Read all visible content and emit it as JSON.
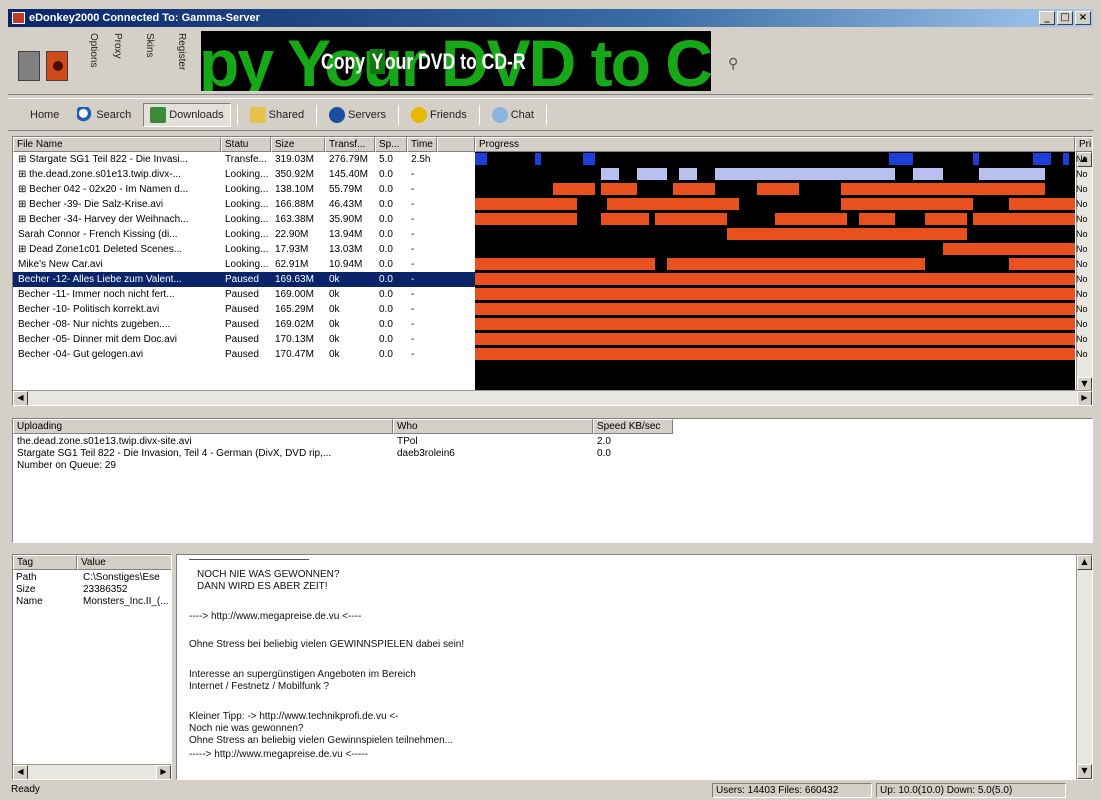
{
  "window": {
    "title": "eDonkey2000 Connected To: Gamma-Server",
    "buttons": [
      "_",
      "□",
      "×"
    ]
  },
  "toolbar": {
    "vertical_labels": [
      "Options",
      "Proxy",
      "Skins",
      "Register"
    ],
    "banner_bg_text": "py Your DVD to CD",
    "banner_fg_pre": "Copy ",
    "banner_fg_y": "Y",
    "banner_fg_post": "our DVD to CD-R"
  },
  "nav": {
    "home": "Home",
    "search": "Search",
    "downloads": "Downloads",
    "shared": "Shared",
    "servers": "Servers",
    "friends": "Friends",
    "chat": "Chat"
  },
  "downloads": {
    "columns": [
      "File Name",
      "Statu",
      "Size",
      "Transf...",
      "Sp...",
      "Time",
      "Progress",
      "Pri"
    ],
    "rows": [
      {
        "name": "⊞ Stargate SG1 Teil 822 - Die Invasi...",
        "status": "Transfe...",
        "size": "319.03M",
        "transf": "276.79M",
        "speed": "5.0",
        "time": "2.5h"
      },
      {
        "name": "⊞ the.dead.zone.s01e13.twip.divx-...",
        "status": "Looking...",
        "size": "350.92M",
        "transf": "145.40M",
        "speed": "0.0",
        "time": "-"
      },
      {
        "name": "⊞ Becher 042 - 02x20 - Im Namen d...",
        "status": "Looking...",
        "size": "138.10M",
        "transf": "55.79M",
        "speed": "0.0",
        "time": "-"
      },
      {
        "name": "⊞ Becher -39- Die Salz-Krise.avi",
        "status": "Looking...",
        "size": "166.88M",
        "transf": "46.43M",
        "speed": "0.0",
        "time": "-"
      },
      {
        "name": "⊞ Becher -34- Harvey der Weihnach...",
        "status": "Looking...",
        "size": "163.38M",
        "transf": "35.90M",
        "speed": "0.0",
        "time": "-"
      },
      {
        "name": "Sarah Connor - French Kissing (di...",
        "status": "Looking...",
        "size": "22.90M",
        "transf": "13.94M",
        "speed": "0.0",
        "time": "-"
      },
      {
        "name": "⊞ Dead Zone1c01 Deleted Scenes...",
        "status": "Looking...",
        "size": "17.93M",
        "transf": "13.03M",
        "speed": "0.0",
        "time": "-"
      },
      {
        "name": "Mike's New Car.avi",
        "status": "Looking...",
        "size": "62.91M",
        "transf": "10.94M",
        "speed": "0.0",
        "time": "-"
      },
      {
        "name": "Becher -12- Alles Liebe zum Valent...",
        "status": "Paused",
        "size": "169.63M",
        "transf": "0k",
        "speed": "0.0",
        "time": "-"
      },
      {
        "name": "Becher -11- Immer noch nicht fert...",
        "status": "Paused",
        "size": "169.00M",
        "transf": "0k",
        "speed": "0.0",
        "time": "-"
      },
      {
        "name": "Becher -10- Politisch korrekt.avi",
        "status": "Paused",
        "size": "165.29M",
        "transf": "0k",
        "speed": "0.0",
        "time": "-"
      },
      {
        "name": "Becher -08- Nur nichts zugeben....",
        "status": "Paused",
        "size": "169.02M",
        "transf": "0k",
        "speed": "0.0",
        "time": "-"
      },
      {
        "name": "Becher -05- Dinner mit dem Doc.avi",
        "status": "Paused",
        "size": "170.13M",
        "transf": "0k",
        "speed": "0.0",
        "time": "-"
      },
      {
        "name": "Becher -04- Gut gelogen.avi",
        "status": "Paused",
        "size": "170.47M",
        "transf": "0k",
        "speed": "0.0",
        "time": "-"
      }
    ],
    "selected_row": 8,
    "priority_label": "No"
  },
  "uploads": {
    "columns": [
      "Uploading",
      "Who",
      "Speed KB/sec"
    ],
    "rows": [
      {
        "file": "the.dead.zone.s01e13.twip.divx-site.avi",
        "who": "TPol",
        "speed": "2.0"
      },
      {
        "file": "Stargate SG1 Teil 822 - Die Invasion, Teil 4 - German (DivX, DVD rip,...",
        "who": "daeb3rolein6",
        "speed": "0.0"
      }
    ],
    "queue_text": "Number on Queue: 29"
  },
  "meta": {
    "columns": [
      "Tag",
      "Value"
    ],
    "rows": [
      {
        "tag": "Path",
        "value": "C:\\Sonstiges\\Ese"
      },
      {
        "tag": "Size",
        "value": "23386352"
      },
      {
        "tag": "Name",
        "value": "Monsters_Inc.II_(..."
      }
    ]
  },
  "messages": {
    "lines": [
      "NOCH NIE WAS GEWONNEN?",
      "DANN WIRD ES ABER ZEIT!",
      "----> http://www.megapreise.de.vu <----",
      "Ohne Stress bei beliebig vielen GEWINNSPIELEN dabei sein!",
      "Interesse an supergünstigen Angeboten im Bereich",
      "Internet / Festnetz / Mobilfunk ?",
      "Kleiner Tipp: -> http://www.technikprofi.de.vu <-",
      "Noch nie was gewonnen?",
      "Ohne Stress an beliebig vielen Gewinnspielen teilnehmen...",
      "-----> http://www.megapreise.de.vu <-----"
    ]
  },
  "status": {
    "left": "Ready",
    "users_files": "Users: 14403  Files: 660432",
    "speed": "Up: 10.0(10.0) Down: 5.0(5.0)"
  },
  "colors": {
    "progress_red": "#e8501e",
    "progress_blue": "#1b3fd8",
    "progress_lightblue": "#b8c0f0",
    "selection": "#0a246a"
  }
}
